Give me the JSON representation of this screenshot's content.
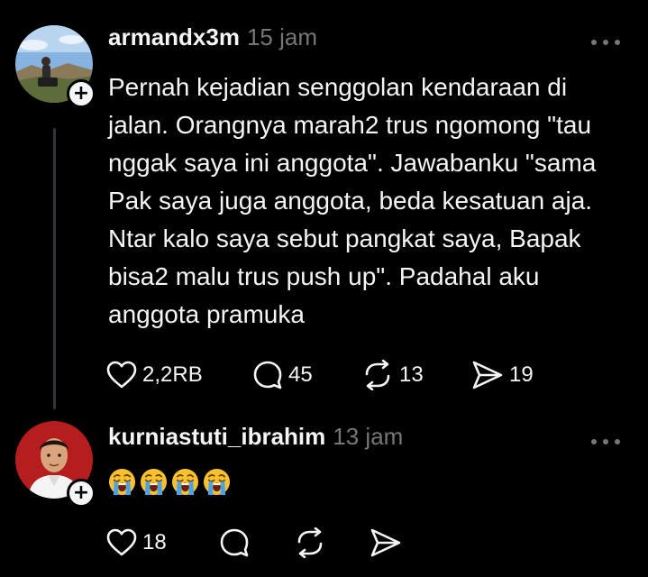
{
  "colors": {
    "background": "#000000",
    "text_primary": "#f3f5f7",
    "text_secondary": "#777777",
    "thread_line": "#333638"
  },
  "posts": [
    {
      "username": "armandx3m",
      "time": "15 jam",
      "text": "Pernah kejadian senggolan kendaraan di\njalan. Orangnya marah2 trus ngomong \"tau\nnggak saya ini anggota\". Jawabanku \"sama\nPak saya juga anggota, beda kesatuan aja.\nNtar kalo saya sebut pangkat saya, Bapak\nbisa2 malu trus push up\". Padahal aku\nanggota pramuka",
      "likes": "2,2RB",
      "replies": "45",
      "reposts": "13",
      "shares": "19",
      "icons": [
        "heart-icon",
        "comment-icon",
        "repost-icon",
        "share-icon",
        "more-icon",
        "plus-icon"
      ]
    },
    {
      "username": "kurniastuti_ibrahim",
      "time": "13 jam",
      "emoji": [
        "loudly-crying-face",
        "loudly-crying-face",
        "loudly-crying-face",
        "loudly-crying-face"
      ],
      "likes": "18",
      "icons": [
        "heart-icon",
        "comment-icon",
        "repost-icon",
        "share-icon",
        "more-icon",
        "plus-icon"
      ]
    }
  ]
}
